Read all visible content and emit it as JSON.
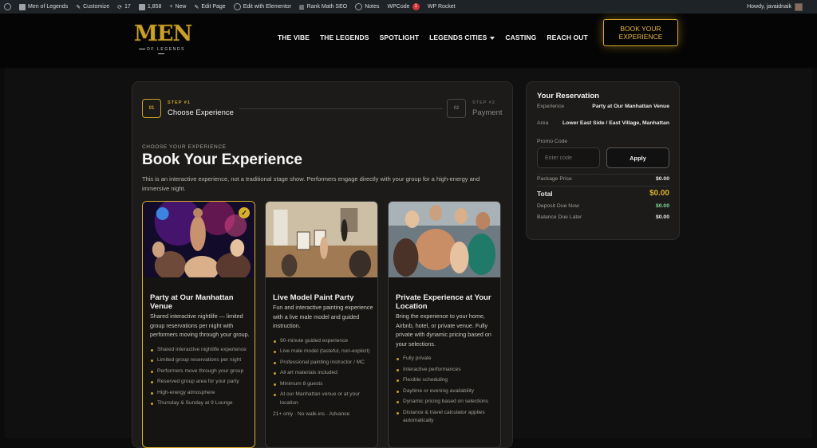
{
  "adminbar": {
    "site": "Men of Legends",
    "customize": "Customize",
    "updates": "17",
    "comments": "1,858",
    "new": "New",
    "edit_page": "Edit Page",
    "elementor": "Edit with Elementor",
    "rankmath": "Rank Math SEO",
    "notes": "Notes",
    "wpcode": "WPCode",
    "wpcode_badge": "1",
    "wprocket": "WP Rocket",
    "howdy": "Howdy, javaidnaik"
  },
  "logo": {
    "main": "MEN",
    "sub": "OF LEGENDS"
  },
  "nav": {
    "items": [
      "THE VIBE",
      "THE LEGENDS",
      "SPOTLIGHT",
      "LEGENDS CITIES",
      "CASTING",
      "REACH OUT"
    ]
  },
  "header": {
    "book_line1": "BOOK YOUR",
    "book_line2": "EXPERIENCE"
  },
  "steps": [
    {
      "num": "STEP #1",
      "box": "01",
      "title": "Choose Experience"
    },
    {
      "num": "STEP #2",
      "box": "02",
      "title": "Payment"
    }
  ],
  "main": {
    "eyebrow": "CHOOSE YOUR EXPERIENCE",
    "title": "Book Your Experience",
    "description": "This is an interactive experience, not a traditional stage show. Performers engage directly with your group for a high-energy and immersive night."
  },
  "cards": [
    {
      "title": "Party at Our Manhattan Venue",
      "subtitle": "Shared interactive nightlife — limited group reservations per night with performers moving through your group.",
      "items": [
        "Shared interactive nightlife experience",
        "Limited group reservations per night",
        "Performers move through your group",
        "Reserved group area for your party",
        "High-energy atmosphere",
        "Thursday & Sunday at 9 Lounge"
      ],
      "foot": "",
      "selected": true
    },
    {
      "title": "Live Model Paint Party",
      "subtitle": "Fun and interactive painting experience with a live male model and guided instruction.",
      "items": [
        "90-minute guided experience",
        "Live male model (tasteful, non-explicit)",
        "Professional painting instructor / MC",
        "All art materials included",
        "Minimum 8 guests",
        "At our Manhattan venue or at your location"
      ],
      "foot": "21+ only · No walk-ins · Advance",
      "selected": false
    },
    {
      "title": "Private Experience at Your Location",
      "subtitle": "Bring the experience to your home, Airbnb, hotel, or private venue. Fully private with dynamic pricing based on your selections.",
      "items": [
        "Fully private",
        "Interactive performances",
        "Flexible scheduling",
        "Daytime or evening availability",
        "Dynamic pricing based on selections",
        "Distance & travel calculator applies automatically"
      ],
      "foot": "",
      "selected": false
    }
  ],
  "reservation": {
    "title": "Your Reservation",
    "experience_label": "Experience",
    "experience_value": "Party at Our Manhattan Venue",
    "area_label": "Area",
    "area_value": "Lower East Side / East Village, Manhattan",
    "promo_label": "Promo Code",
    "promo_placeholder": "Enter code",
    "apply": "Apply",
    "package_label": "Package Price",
    "package_value": "$0.00",
    "total_label": "Total",
    "total_value": "$0.00",
    "deposit_label": "Deposit Due Now",
    "deposit_value": "$0.00",
    "balance_label": "Balance Due Later",
    "balance_value": "$0.00"
  },
  "colors": {
    "accent": "#d9ae2c",
    "deposit": "#7fd99a",
    "background": "#0b0b0b"
  }
}
